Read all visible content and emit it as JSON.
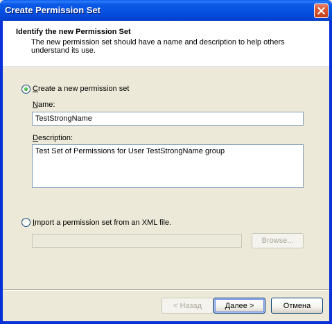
{
  "window": {
    "title": "Create Permission Set"
  },
  "header": {
    "title": "Identify the new Permission Set",
    "description": "The new permission set should have a name and description to help others understand its use."
  },
  "create_option": {
    "label_prefix": "C",
    "label_rest": "reate a new permission set",
    "selected": true
  },
  "name_field": {
    "label_prefix": "N",
    "label_rest": "ame:",
    "value": "TestStrongName"
  },
  "description_field": {
    "label_prefix": "D",
    "label_rest": "escription:",
    "value": "Test Set of Permissions for User TestStrongName group"
  },
  "import_option": {
    "label_prefix": "I",
    "label_rest": "mport a permission set from an XML file.",
    "selected": false
  },
  "import_path": {
    "value": ""
  },
  "buttons": {
    "browse": "Browse...",
    "back": "< Назад",
    "next": "Далее >",
    "cancel": "Отмена"
  }
}
